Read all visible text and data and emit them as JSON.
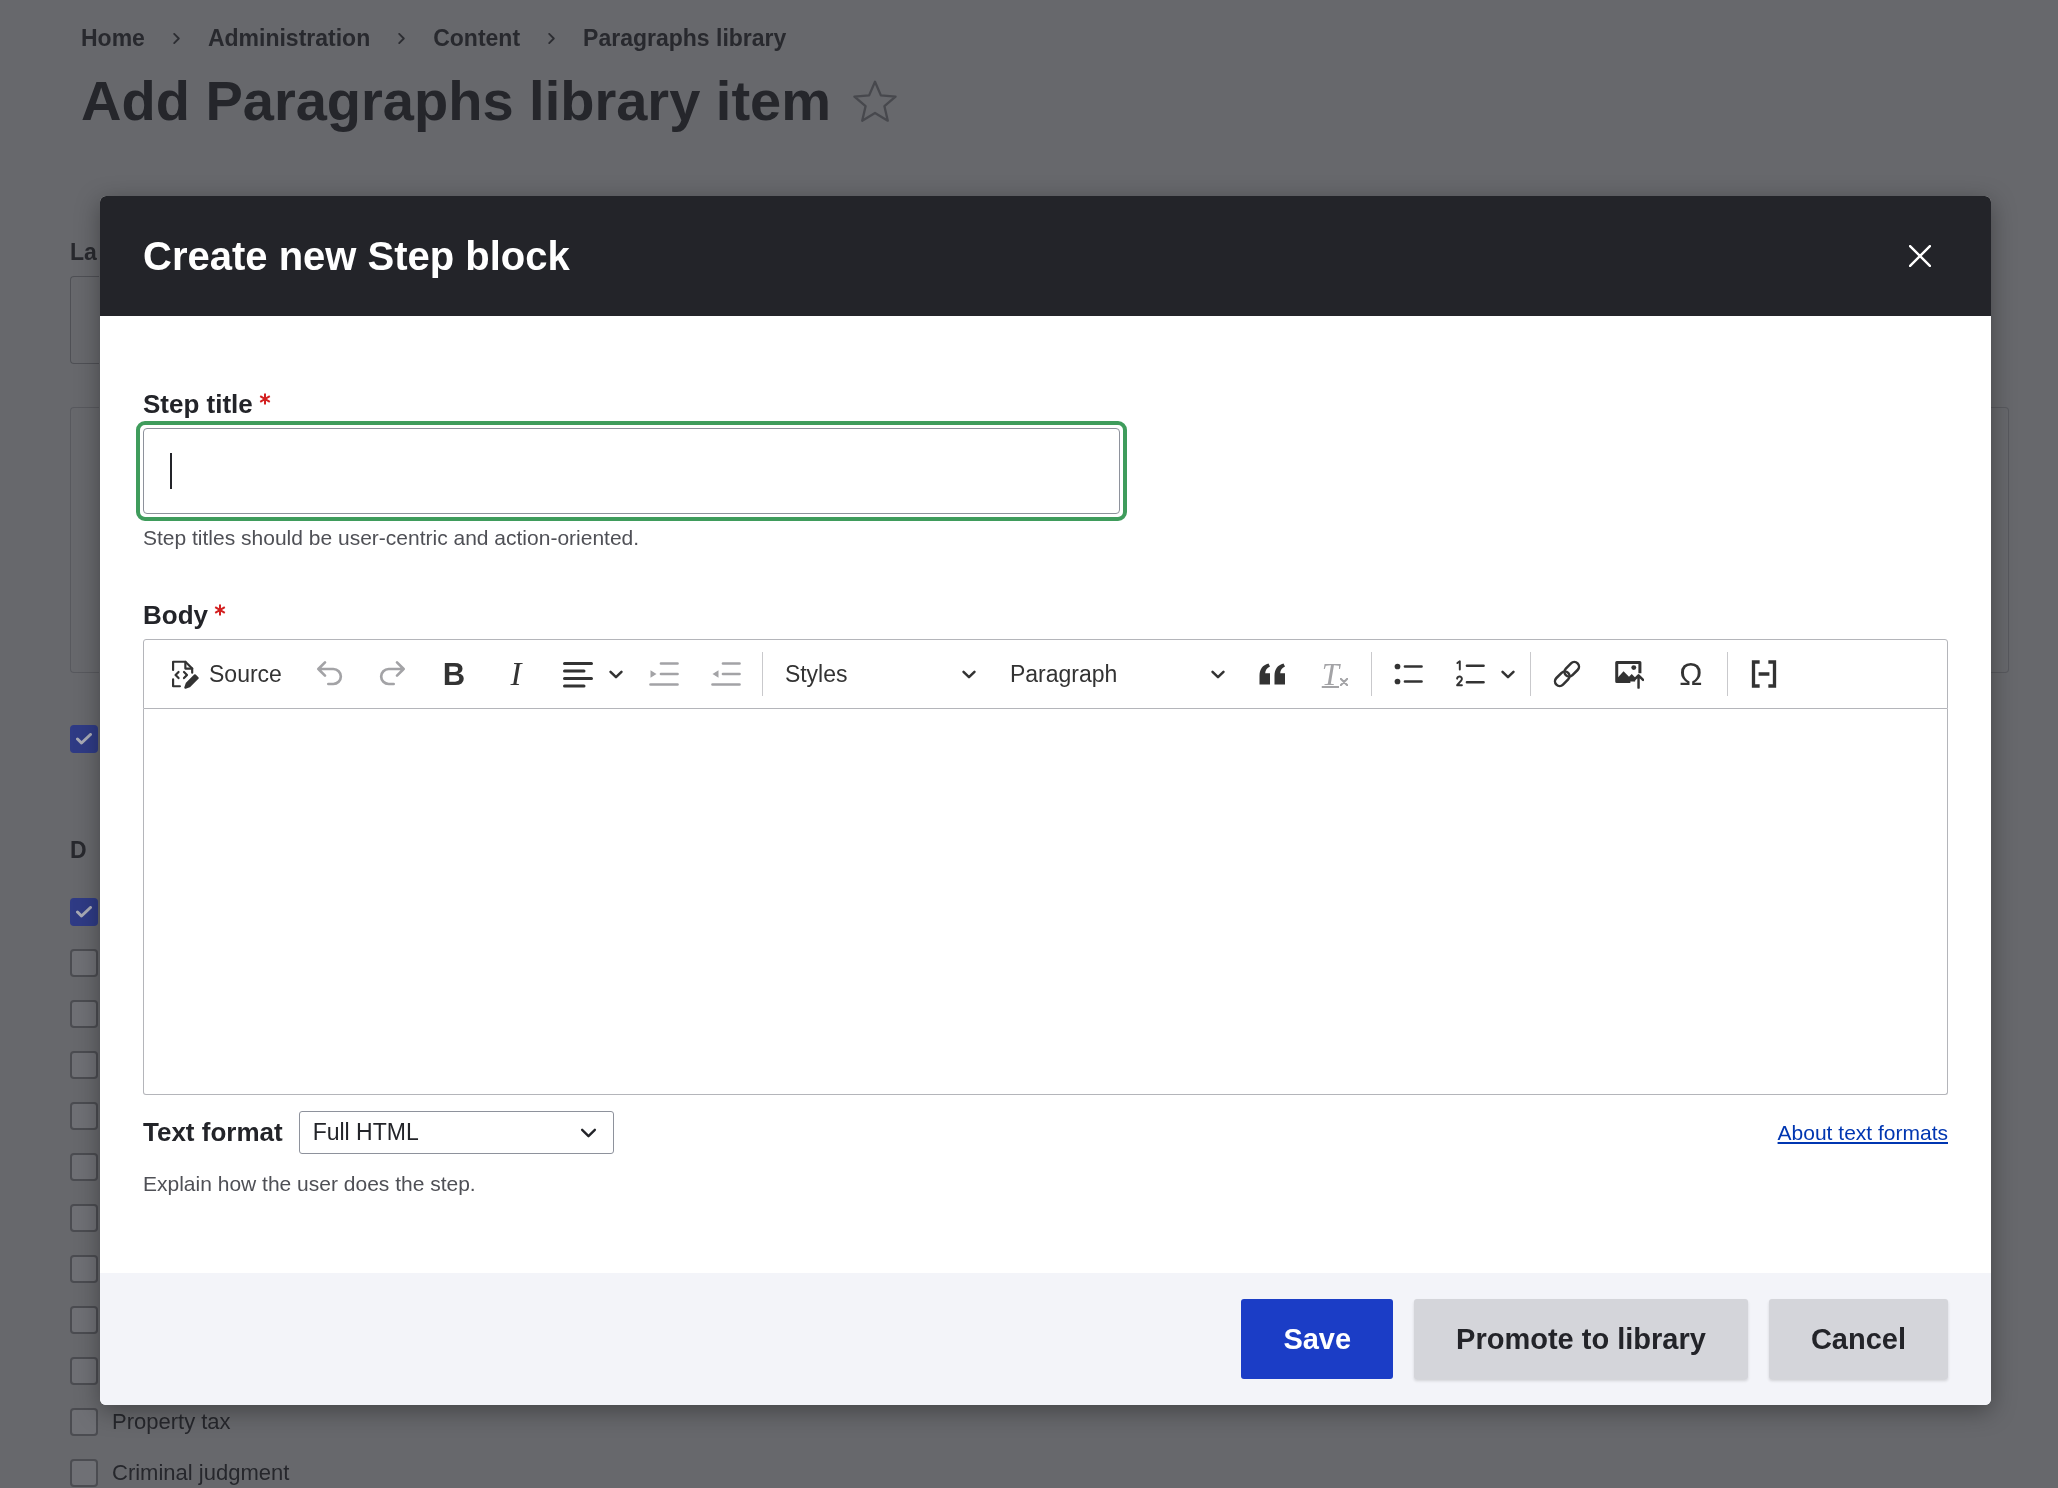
{
  "page": {
    "breadcrumb": [
      {
        "label": "Home"
      },
      {
        "label": "Administration"
      },
      {
        "label": "Content"
      },
      {
        "label": "Paragraphs library"
      }
    ],
    "title": "Add Paragraphs library item",
    "form": {
      "label_1": "La",
      "checkbox_1": {
        "checked": true
      },
      "label_2": "D",
      "checkboxes": [
        {
          "checked": true
        },
        {
          "checked": false
        },
        {
          "checked": false
        },
        {
          "checked": false
        },
        {
          "checked": false
        },
        {
          "checked": false
        },
        {
          "checked": false
        },
        {
          "checked": false
        },
        {
          "checked": false
        },
        {
          "checked": false
        },
        {
          "label": "Property tax",
          "checked": false
        },
        {
          "label": "Criminal judgment",
          "checked": false
        }
      ]
    }
  },
  "dialog": {
    "title": "Create new Step block",
    "step_title": {
      "label": "Step title",
      "required": true,
      "focused": true,
      "description": "Step titles should be user-centric and action-oriented."
    },
    "body": {
      "label": "Body",
      "required": true,
      "toolbar": [
        [
          {
            "kind": "button",
            "label": "Source",
            "disabled": false
          },
          {
            "kind": "button",
            "disabled": true
          },
          {
            "kind": "button",
            "disabled": true
          },
          {
            "kind": "button",
            "glyph": "B",
            "disabled": false
          },
          {
            "kind": "button",
            "glyph": "I",
            "disabled": false
          },
          {
            "kind": "split",
            "disabled": false
          },
          {
            "kind": "button",
            "disabled": true
          },
          {
            "kind": "button",
            "disabled": true
          }
        ],
        [
          {
            "kind": "dropdown",
            "label": "Styles",
            "disabled": false
          },
          {
            "kind": "dropdown",
            "label": "Paragraph",
            "disabled": false
          },
          {
            "kind": "button",
            "disabled": false
          },
          {
            "kind": "button",
            "glyph": "T",
            "disabled": true
          }
        ],
        [
          {
            "kind": "button",
            "disabled": false
          },
          {
            "kind": "split",
            "disabled": false
          }
        ],
        [
          {
            "kind": "button",
            "disabled": false
          },
          {
            "kind": "button",
            "disabled": false
          },
          {
            "kind": "button",
            "glyph": "Ω",
            "disabled": false
          }
        ],
        [
          {
            "kind": "button",
            "disabled": false
          }
        ]
      ],
      "text_format": {
        "label": "Text format",
        "value": "Full HTML"
      },
      "help_link": "About text formats",
      "description": "Explain how the user does the step."
    },
    "buttons": [
      {
        "label": "Save",
        "kind": "primary"
      },
      {
        "label": "Promote to library",
        "kind": "secondary"
      },
      {
        "label": "Cancel",
        "kind": "secondary"
      }
    ]
  }
}
